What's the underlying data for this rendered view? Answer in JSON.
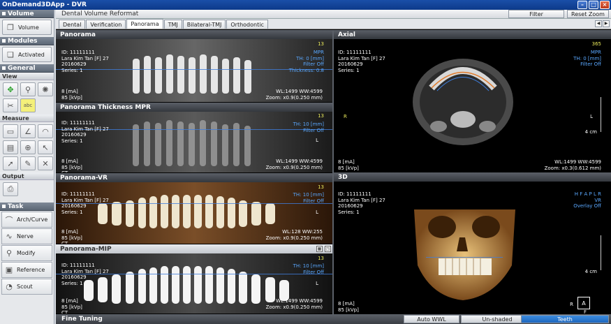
{
  "window": {
    "title": "OnDemand3DApp - DVR"
  },
  "left": {
    "volume": {
      "header": "Volume",
      "button": "Volume"
    },
    "modules": {
      "header": "Modules",
      "button": "Activated"
    },
    "general": {
      "header": "General",
      "view_label": "View",
      "view_tools": [
        "move-icon",
        "zoom-icon",
        "brightness-icon",
        "scissors-icon",
        "annotation-icon"
      ],
      "measure_label": "Measure",
      "measure_tools": [
        "ruler-icon",
        "angle-icon",
        "protractor-icon",
        "area-icon",
        "profile-icon",
        "arrow-tool-icon",
        "cursor-icon",
        "eraser-icon",
        "delete-icon"
      ],
      "output_label": "Output"
    },
    "task": {
      "header": "Task",
      "items": [
        {
          "label": "Arch/Curve",
          "icon": "arch-icon"
        },
        {
          "label": "Nerve",
          "icon": "nerve-icon"
        },
        {
          "label": "Modify",
          "icon": "modify-icon"
        },
        {
          "label": "Reference",
          "icon": "reference-icon"
        },
        {
          "label": "Scout",
          "icon": "scout-icon"
        }
      ]
    }
  },
  "main": {
    "title": "Dental Volume Reformat",
    "filter_button": "Filter",
    "reset_zoom_button": "Reset Zoom",
    "tabs": [
      "Dental",
      "Verification",
      "Panorama",
      "TMJ",
      "Bilateral-TMJ",
      "Orthodontic"
    ],
    "active_tab": "Panorama",
    "patient": {
      "id": "ID: 11111111",
      "name": "Lara Kim Tan [F] 27",
      "date": "20160629",
      "series": "Series: 1",
      "ma": "8 [mA]",
      "kvp": "85 [kVp]",
      "modality": "CT"
    },
    "viewports": {
      "panorama": {
        "title": "Panorama",
        "slice": "13",
        "info": "MPR\nTH: 0 [mm]\nFilter Off\nThickness: 0.8",
        "wl": "WL:1499 WW:4599",
        "zoom": "Zoom: x0.9(0.250 mm)"
      },
      "thickness": {
        "title": "Panorama Thickness MPR",
        "slice": "13",
        "info": "TH: 10 [mm]\nFilter Off",
        "marker": "L",
        "wl": "WL:1499 WW:4599",
        "zoom": "Zoom: x0.9(0.250 mm)"
      },
      "vr": {
        "title": "Panorama-VR",
        "slice": "13",
        "info": "TH: 10 [mm]\nFilter Off",
        "marker": "L",
        "wl": "WL:128 WW:255",
        "zoom": "Zoom: x0.9(0.250 mm)"
      },
      "mip": {
        "title": "Panorama-MIP",
        "slice": "13",
        "info": "TH: 10 [mm]\nFilter Off",
        "marker": "L",
        "wl": "WL:1499 WW:4599",
        "zoom": "Zoom: x0.9(0.250 mm)"
      },
      "axial": {
        "title": "Axial",
        "slice": "365",
        "info": "MPR\nTH: 0 [mm]\nFilter Off",
        "left_marker": "R",
        "right_marker": "L",
        "scale": "4 cm",
        "wl": "WL:1499 WW:4599",
        "zoom": "Zoom: x0.3(0.612 mm)"
      },
      "threed": {
        "title": "3D",
        "info": "H F A P L R\nVR\nOverlay Off",
        "scale": "4 cm",
        "orient_left": "R",
        "orient_box": "A",
        "orient_bottom": "F"
      }
    },
    "bottom": {
      "label": "Fine Tuning",
      "buttons": [
        "Auto WWL",
        "Un-shaded",
        "Teeth"
      ],
      "selected": "Teeth"
    }
  }
}
